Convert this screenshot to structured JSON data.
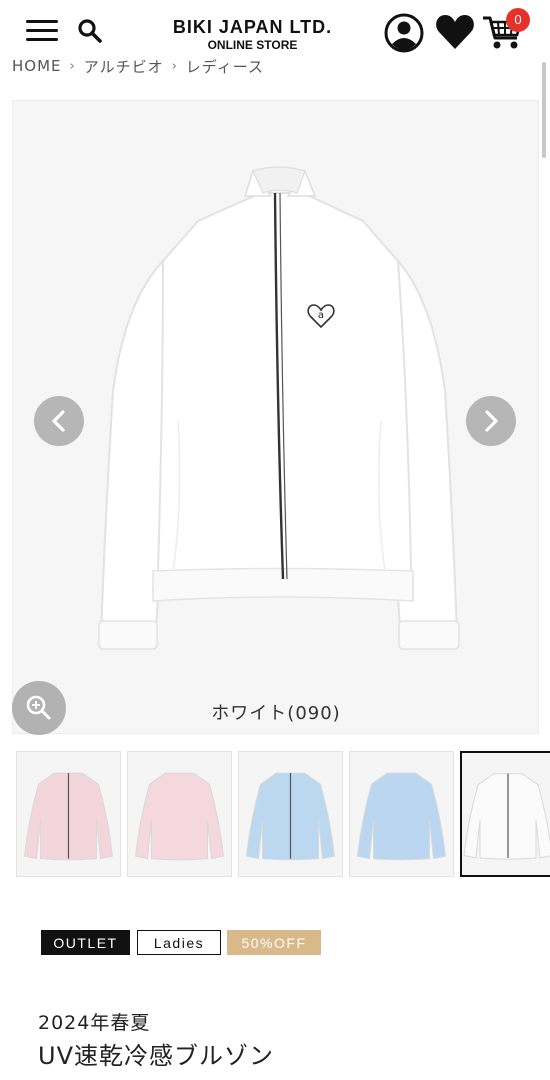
{
  "header": {
    "brand_name": "BIKI JAPAN LTD.",
    "brand_sub": "ONLINE STORE",
    "cart_count": "0",
    "icons": [
      "menu-icon",
      "search-icon",
      "account-icon",
      "heart-icon",
      "cart-icon"
    ]
  },
  "breadcrumb": {
    "items": [
      "HOME",
      "アルチビオ",
      "レディース"
    ],
    "separator": "›"
  },
  "gallery": {
    "color_caption": "ホワイト(090)",
    "thumbnail_colors": [
      "#f3d6dc",
      "#f4d8dd",
      "#bcd8f0",
      "#bad6f0",
      "#fbfbfb"
    ],
    "selected_thumbnail": 4
  },
  "tags": {
    "outlet": "OUTLET",
    "ladies": "Ladies",
    "sale": "50%OFF"
  },
  "product": {
    "season": "2024年春夏",
    "title": "UV速乾冷感ブルゾン"
  },
  "colors": {
    "badge": "#e5322d",
    "sale_tag": "#d9b98a",
    "outlet_tag": "#111111"
  }
}
